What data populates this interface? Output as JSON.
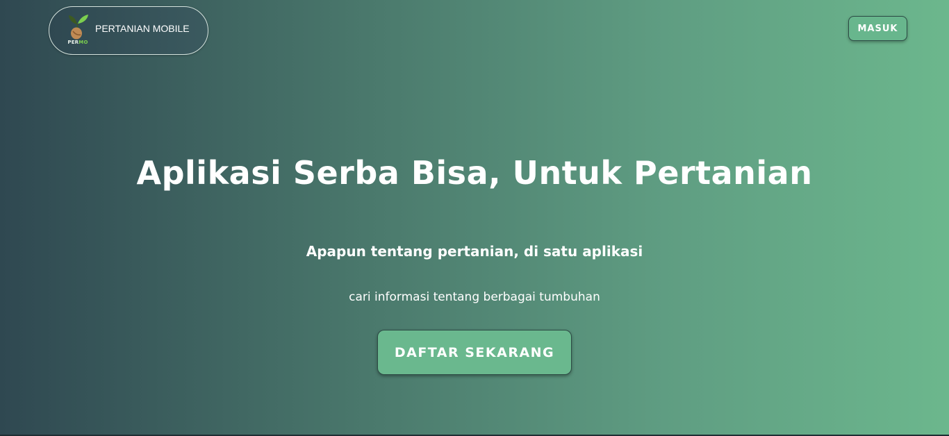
{
  "header": {
    "logo": {
      "icon": "seed-sprout-icon",
      "text_part1": "PER",
      "text_part2": "MO",
      "colors": {
        "part1": "#e8f0ea",
        "part2": "#7ccf4f"
      }
    },
    "brand_name": "PERTANIAN MOBILE",
    "login_label": "MASUK"
  },
  "hero": {
    "title": "Aplikasi Serba Bisa, Untuk Pertanian",
    "subtitle": "Apapun tentang pertanian, di satu aplikasi",
    "description": "cari informasi tentang berbagai tumbuhan",
    "cta_label": "DAFTAR SEKARANG"
  },
  "colors": {
    "gradient_start": "#2f4851",
    "gradient_end": "#6cb78d",
    "button_bg": "#68b68d",
    "text": "#ffffff"
  }
}
